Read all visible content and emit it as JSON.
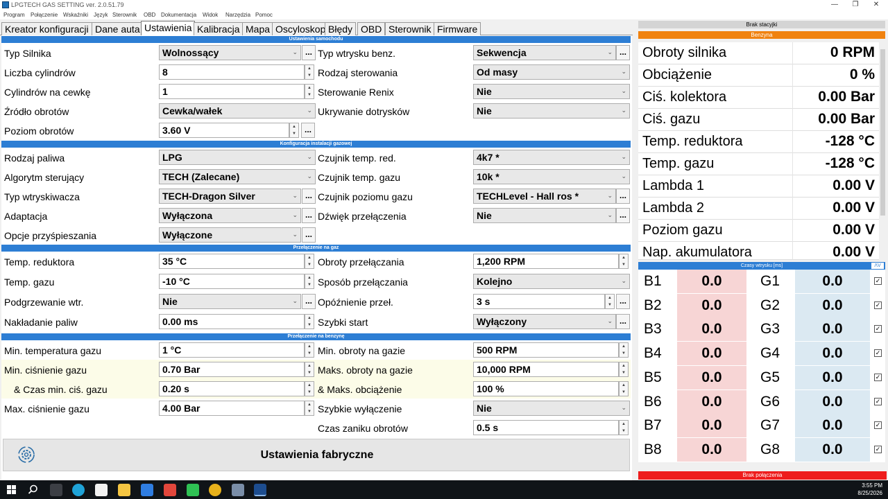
{
  "window": {
    "title": "LPGTECH GAS SETTING ver. 2.0.51.79"
  },
  "menu": [
    "Program",
    "Połączenie",
    "Wskaźniki",
    "Język",
    "Sterownik",
    "OBD",
    "Dokumentacja",
    "Widok",
    "Narzędzia",
    "Pomoc"
  ],
  "tabs": [
    "Kreator konfiguracji",
    "Dane auta",
    "Ustawienia",
    "Kalibracja",
    "Mapa",
    "Oscyloskop",
    "Błędy",
    "OBD",
    "Sterownik",
    "Firmware"
  ],
  "sections": {
    "vehicle": "Ustawienia samochodu",
    "gas_install": "Konfiguracja instalacji gazowej",
    "switch_gas": "Przełączenie na gaz",
    "switch_petrol": "Przełączenie na benzynę"
  },
  "vehicle": {
    "engine_type": {
      "label": "Typ Silnika",
      "value": "Wolnossący"
    },
    "cylinders": {
      "label": "Liczba cylindrów",
      "value": "8"
    },
    "cyl_per_coil": {
      "label": "Cylindrów na cewkę",
      "value": "1"
    },
    "rpm_source": {
      "label": "Źródło obrotów",
      "value": "Cewka/wałek"
    },
    "rpm_level": {
      "label": "Poziom obrotów",
      "value": "3.60 V"
    },
    "petrol_inj_type": {
      "label": "Typ wtrysku benz.",
      "value": "Sekwencja"
    },
    "control_type": {
      "label": "Rodzaj sterowania",
      "value": "Od masy"
    },
    "renix": {
      "label": "Sterowanie Renix",
      "value": "Nie"
    },
    "hide_extra": {
      "label": "Ukrywanie dotrysków",
      "value": "Nie"
    }
  },
  "gas_install": {
    "fuel_type": {
      "label": "Rodzaj paliwa",
      "value": "LPG"
    },
    "algorithm": {
      "label": "Algorytm sterujący",
      "value": "TECH (Zalecane)"
    },
    "injector_type": {
      "label": "Typ wtryskiwacza",
      "value": "TECH-Dragon Silver"
    },
    "adaptation": {
      "label": "Adaptacja",
      "value": "Wyłączona"
    },
    "accel_options": {
      "label": "Opcje przyśpieszania",
      "value": "Wyłączone"
    },
    "reducer_temp_sensor": {
      "label": "Czujnik temp. red.",
      "value": "4k7 *"
    },
    "gas_temp_sensor": {
      "label": "Czujnik temp. gazu",
      "value": "10k *"
    },
    "gas_level_sensor": {
      "label": "Czujnik poziomu gazu",
      "value": "TECHLevel - Hall ros *"
    },
    "switch_sound": {
      "label": "Dźwięk przełączenia",
      "value": "Nie"
    }
  },
  "switch_gas": {
    "reducer_temp": {
      "label": "Temp. reduktora",
      "value": "35 °C"
    },
    "gas_temp": {
      "label": "Temp. gazu",
      "value": "-10 °C"
    },
    "inj_heating": {
      "label": "Podgrzewanie wtr.",
      "value": "Nie"
    },
    "fuel_overlap": {
      "label": "Nakładanie paliw",
      "value": "0.00 ms"
    },
    "switch_rpm": {
      "label": "Obroty przełączania",
      "value": "1,200 RPM"
    },
    "switch_mode": {
      "label": "Sposób przełączania",
      "value": "Kolejno"
    },
    "switch_delay": {
      "label": "Opóźnienie przeł.",
      "value": "3 s"
    },
    "quick_start": {
      "label": "Szybki start",
      "value": "Wyłączony"
    }
  },
  "switch_petrol": {
    "min_gas_temp": {
      "label": "Min. temperatura gazu",
      "value": "1 °C"
    },
    "min_gas_pressure": {
      "label": "Min. ciśnienie gazu",
      "value": "0.70 Bar"
    },
    "min_pressure_time": {
      "label": "& Czas min. ciś. gazu",
      "value": "0.20 s"
    },
    "max_gas_pressure": {
      "label": "Max. ciśnienie gazu",
      "value": "4.00 Bar"
    },
    "min_rpm_gas": {
      "label": "Min. obroty na gazie",
      "value": "500 RPM"
    },
    "max_rpm_gas": {
      "label": "Maks. obroty na gazie",
      "value": "10,000 RPM"
    },
    "max_load": {
      "label": "& Maks. obciążenie",
      "value": "100 %"
    },
    "quick_off": {
      "label": "Szybkie wyłączenie",
      "value": "Nie"
    },
    "rpm_decay": {
      "label": "Czas zaniku obrotów",
      "value": "0.5 s"
    }
  },
  "factory_button": "Ustawienia fabryczne",
  "status": {
    "station": "Brak stacyjki",
    "fuel": "Benzyna",
    "connection": "Brak połączenia"
  },
  "params": [
    {
      "name": "Obroty silnika",
      "value": "0 RPM"
    },
    {
      "name": "Obciążenie",
      "value": "0 %"
    },
    {
      "name": "Ciś. kolektora",
      "value": "0.00 Bar"
    },
    {
      "name": "Ciś. gazu",
      "value": "0.00 Bar"
    },
    {
      "name": "Temp. reduktora",
      "value": "-128 °C"
    },
    {
      "name": "Temp. gazu",
      "value": "-128 °C"
    },
    {
      "name": "Lambda 1",
      "value": "0.00 V"
    },
    {
      "name": "Lambda 2",
      "value": "0.00 V"
    },
    {
      "name": "Poziom gazu",
      "value": "0.00 V"
    },
    {
      "name": "Nap. akumulatora",
      "value": "0.00 V"
    }
  ],
  "injection_header": "Czasy wtrysku [ms]",
  "injection": [
    {
      "b": "B1",
      "bv": "0.0",
      "g": "G1",
      "gv": "0.0"
    },
    {
      "b": "B2",
      "bv": "0.0",
      "g": "G2",
      "gv": "0.0"
    },
    {
      "b": "B3",
      "bv": "0.0",
      "g": "G3",
      "gv": "0.0"
    },
    {
      "b": "B4",
      "bv": "0.0",
      "g": "G4",
      "gv": "0.0"
    },
    {
      "b": "B5",
      "bv": "0.0",
      "g": "G5",
      "gv": "0.0"
    },
    {
      "b": "B6",
      "bv": "0.0",
      "g": "G6",
      "gv": "0.0"
    },
    {
      "b": "B7",
      "bv": "0.0",
      "g": "G7",
      "gv": "0.0"
    },
    {
      "b": "B8",
      "bv": "0.0",
      "g": "G8",
      "gv": "0.0"
    }
  ],
  "taskbar": {
    "time": "3:55 PM",
    "date": "8/25/2026"
  },
  "colors": {
    "accent": "#2d7ed4",
    "fuel_status": "#f0820f",
    "error": "#ee1c1c",
    "petrol_cell": "#f7d5d5",
    "gas_cell": "#dbe9f2",
    "highlight_row": "#fcfce8"
  }
}
